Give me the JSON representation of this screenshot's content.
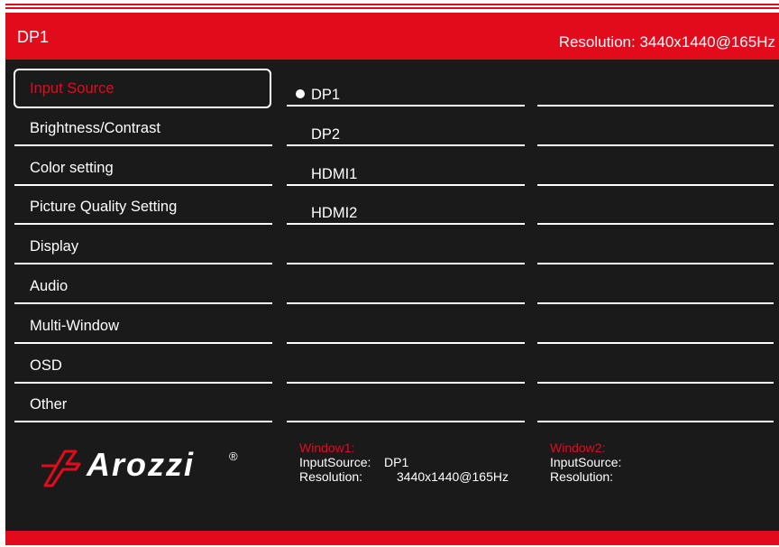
{
  "header": {
    "source": "DP1",
    "resolution": "Resolution: 3440x1440@165Hz"
  },
  "menu": {
    "items": [
      {
        "label": "Input Source",
        "selected": true
      },
      {
        "label": "Brightness/Contrast"
      },
      {
        "label": "Color setting"
      },
      {
        "label": "Picture Quality Setting"
      },
      {
        "label": "Display"
      },
      {
        "label": "Audio"
      },
      {
        "label": "Multi-Window"
      },
      {
        "label": "OSD"
      },
      {
        "label": "Other"
      }
    ]
  },
  "options": {
    "items": [
      {
        "label": "DP1",
        "selected": true
      },
      {
        "label": "DP2"
      },
      {
        "label": "HDMI1"
      },
      {
        "label": "HDMI2"
      }
    ]
  },
  "brand": {
    "name": "Arozzi",
    "registered": "®"
  },
  "window1": {
    "title": "Window1:",
    "input_label": "InputSource:",
    "input_value": "DP1",
    "resolution_label": "Resolution:",
    "resolution_value": "3440x1440@165Hz"
  },
  "window2": {
    "title": "Window2:",
    "input_label": "InputSource:",
    "resolution_label": "Resolution:"
  },
  "colors": {
    "accent": "#e20b1c",
    "background": "#1a1a1a",
    "text": "#ffffff"
  }
}
